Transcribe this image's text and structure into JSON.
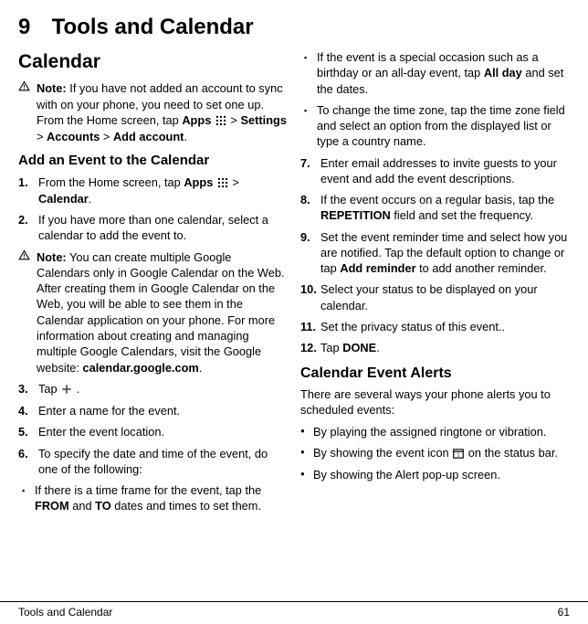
{
  "chapter": {
    "num": "9",
    "title": "Tools and Calendar"
  },
  "calendar": {
    "heading": "Calendar",
    "note1_label": "Note:",
    "note1_a": " If you have not added an account to sync with on your phone, you need to set one up. From the Home screen, tap ",
    "note1_apps": "Apps",
    "note1_b": " > ",
    "note1_settings": "Settings",
    "note1_c": " > ",
    "note1_accounts": "Accounts",
    "note1_d": " > ",
    "note1_addacct": "Add account",
    "note1_e": ".",
    "add_heading": "Add an Event to the Calendar",
    "s1_a": "From the Home screen, tap ",
    "s1_apps": "Apps",
    "s1_b": " > ",
    "s1_cal": "Calendar",
    "s1_c": ".",
    "s2": "If you have more than one calendar, select a calendar to add the event to.",
    "note2_label": "Note:",
    "note2_a": " You can create multiple Google Calendars only in Google Calendar on the Web. After creating them in Google Calendar on the Web, you will be able to see them in the Calendar application on your phone. For more information about creating and managing multiple Google Calendars, visit the Google website: ",
    "note2_url": "calendar.google.com",
    "note2_b": ".",
    "s3_a": "Tap ",
    "s3_b": " .",
    "s4": "Enter a name for the event.",
    "s5": "Enter the event location.",
    "s6": "To specify the date and time of the event, do one of the following:",
    "s6_sub1_a": "If there is a time frame for the event, tap the ",
    "s6_sub1_from": "FROM",
    "s6_sub1_b": " and ",
    "s6_sub1_to": "TO",
    "s6_sub1_c": " dates and times to set them.",
    "s6_sub2_a": "If the event is a special occasion such as a birthday or an all-day event, tap ",
    "s6_sub2_allday": "All day",
    "s6_sub2_b": " and set the dates.",
    "s6_sub3": "To change the time zone, tap the time zone field and select an option from the displayed list or type a country name.",
    "s7": "Enter email addresses to invite guests to your event and add the event descriptions.",
    "s8_a": "If the event occurs on a regular basis, tap the ",
    "s8_rep": "REPETITION",
    "s8_b": " field and set the frequency.",
    "s9_a": "Set the event reminder time and select how you are notified. Tap the default option to change or tap ",
    "s9_addrem": "Add reminder",
    "s9_b": " to add another reminder.",
    "s10": "Select your status to be displayed on your calendar.",
    "s11": "Set the privacy status of this event..",
    "s12_a": "Tap ",
    "s12_done": "DONE",
    "s12_b": ".",
    "alerts_heading": "Calendar Event Alerts",
    "alerts_intro": "There are several ways your phone alerts you to scheduled events:",
    "a1": "By playing the assigned ringtone or vibration.",
    "a2_a": "By showing the event icon ",
    "a2_b": " on the status bar.",
    "a3": "By showing the Alert pop-up screen.",
    "n1": "1.",
    "n2": "2.",
    "n3": "3.",
    "n4": "4.",
    "n5": "5.",
    "n6": "6.",
    "n7": "7.",
    "n8": "8.",
    "n9": "9.",
    "n10": "10.",
    "n11": "11.",
    "n12": "12."
  },
  "footer": {
    "left": "Tools and Calendar",
    "right": "61"
  }
}
